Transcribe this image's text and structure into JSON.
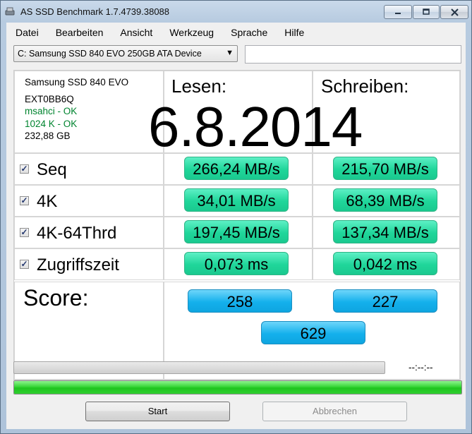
{
  "window": {
    "title": "AS SSD Benchmark 1.7.4739.38088"
  },
  "menu": [
    "Datei",
    "Bearbeiten",
    "Ansicht",
    "Werkzeug",
    "Sprache",
    "Hilfe"
  ],
  "drive_select": {
    "value": "C: Samsung SSD 840 EVO 250GB ATA Device"
  },
  "info": {
    "model": "Samsung SSD 840 EVO",
    "firmware": "EXT0BB6Q",
    "driver": "msahci - OK",
    "alignment": "1024 K - OK",
    "capacity": "232,88 GB"
  },
  "headers": {
    "read": "Lesen:",
    "write": "Schreiben:"
  },
  "date_overlay": "6.8.2014",
  "rows": [
    {
      "name": "Seq",
      "checked": true,
      "read": "266,24 MB/s",
      "write": "215,70 MB/s"
    },
    {
      "name": "4K",
      "checked": true,
      "read": "34,01 MB/s",
      "write": "68,39 MB/s"
    },
    {
      "name": "4K-64Thrd",
      "checked": true,
      "read": "197,45 MB/s",
      "write": "137,34 MB/s"
    },
    {
      "name": "Zugriffszeit",
      "checked": true,
      "read": "0,073 ms",
      "write": "0,042 ms"
    }
  ],
  "score": {
    "label": "Score:",
    "read": "258",
    "write": "227",
    "total": "629"
  },
  "progress": {
    "time_text": "--:--:--",
    "overall_fraction": 1.0
  },
  "buttons": {
    "start": "Start",
    "cancel": "Abbrechen"
  },
  "colors": {
    "result_green": "#20d69a",
    "score_blue": "#14b0ec",
    "progress_green": "#37d637",
    "ok_text": "#00842f"
  }
}
